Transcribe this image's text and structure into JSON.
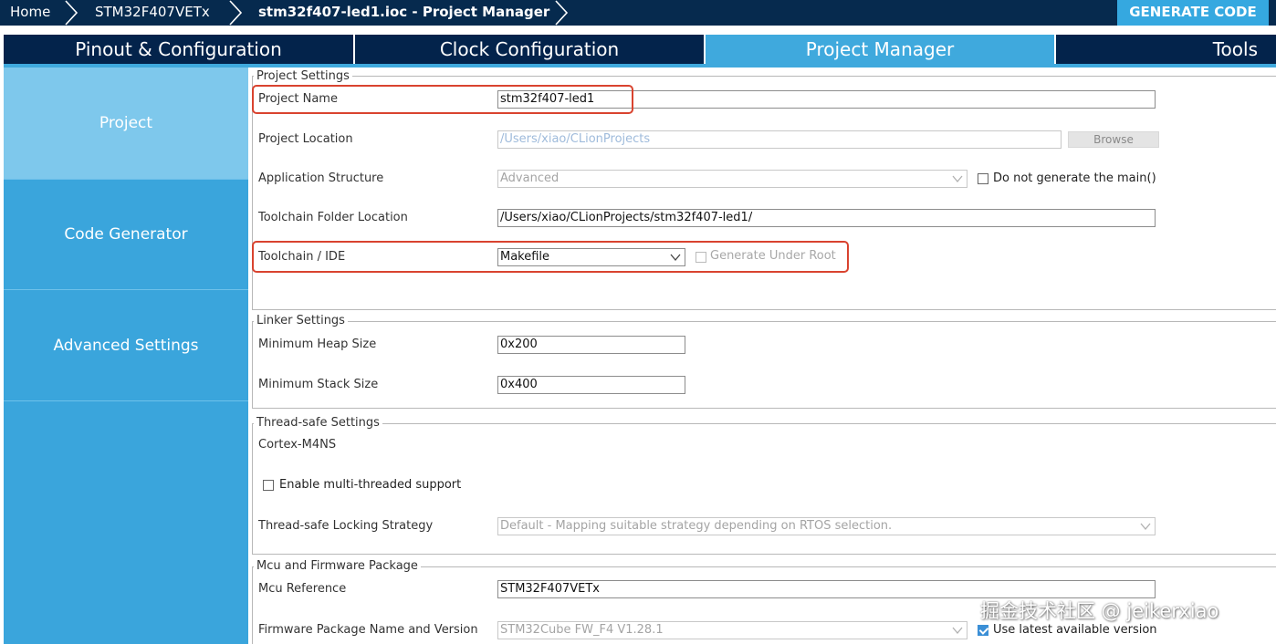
{
  "breadcrumb": {
    "home": "Home",
    "device": "STM32F407VETx",
    "file": "stm32f407-led1.ioc - Project Manager"
  },
  "generate_code_label": "GENERATE CODE",
  "tabs": [
    {
      "label": "Pinout & Configuration",
      "active": false
    },
    {
      "label": "Clock Configuration",
      "active": false
    },
    {
      "label": "Project Manager",
      "active": true
    },
    {
      "label": "Tools",
      "active": false
    }
  ],
  "sidebar": {
    "items": [
      {
        "label": "Project",
        "active": true
      },
      {
        "label": "Code Generator",
        "active": false
      },
      {
        "label": "Advanced Settings",
        "active": false
      }
    ]
  },
  "project_settings": {
    "legend": "Project Settings",
    "project_name_label": "Project Name",
    "project_name_value": "stm32f407-led1",
    "project_location_label": "Project Location",
    "project_location_value": "/Users/xiao/CLionProjects",
    "browse_label": "Browse",
    "app_structure_label": "Application Structure",
    "app_structure_value": "Advanced",
    "no_main_label": "Do not generate the main()",
    "toolchain_folder_label": "Toolchain Folder Location",
    "toolchain_folder_value": "/Users/xiao/CLionProjects/stm32f407-led1/",
    "toolchain_ide_label": "Toolchain / IDE",
    "toolchain_ide_value": "Makefile",
    "generate_under_root_label": "Generate Under Root"
  },
  "linker_settings": {
    "legend": "Linker Settings",
    "heap_label": "Minimum Heap Size",
    "heap_value": "0x200",
    "stack_label": "Minimum Stack Size",
    "stack_value": "0x400"
  },
  "thread_safe": {
    "legend": "Thread-safe Settings",
    "core_label": "Cortex-M4NS",
    "multithread_label": "Enable multi-threaded support",
    "locking_label": "Thread-safe Locking Strategy",
    "locking_value": "Default - Mapping suitable strategy depending on RTOS selection."
  },
  "mcu_firmware": {
    "legend": "Mcu and Firmware Package",
    "mcu_ref_label": "Mcu Reference",
    "mcu_ref_value": "STM32F407VETx",
    "fw_label": "Firmware Package Name and Version",
    "fw_value": "STM32Cube FW_F4 V1.28.1",
    "use_latest_label": "Use latest available version"
  },
  "watermark": "掘金技术社区 @ jeikerxiao",
  "colors": {
    "top_bar": "#062a4e",
    "tab_bg": "#03234b",
    "accent": "#3fa9dd",
    "nav_active": "#7ec8ec",
    "highlight": "#d9432f"
  }
}
